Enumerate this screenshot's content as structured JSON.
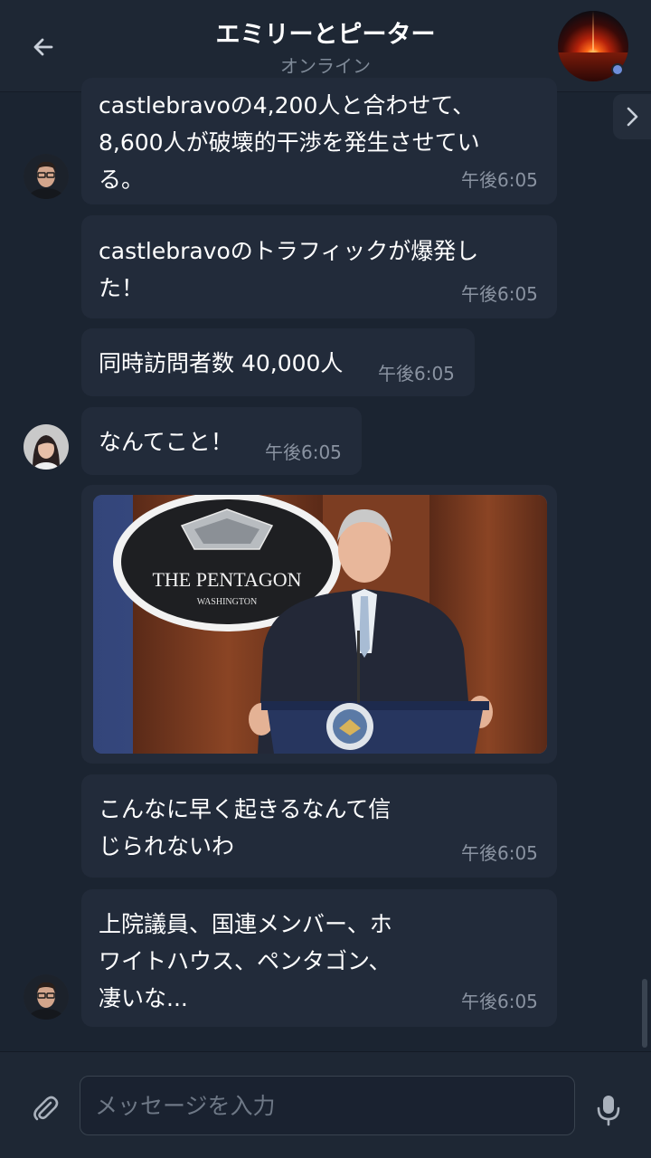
{
  "header": {
    "title": "エミリーとピーター",
    "status": "オンライン"
  },
  "messages": [
    {
      "text": "castlebravoの4,200人と合わせて、\n8,600人が破壊的干渉を発生させてい\nる。",
      "time": "午後6:05"
    },
    {
      "text": "castlebravoのトラフィックが爆発し\nた！",
      "time": "午後6:05"
    },
    {
      "text": "同時訪問者数 40,000人",
      "time": "午後6:05"
    },
    {
      "text": "なんてこと！",
      "time": "午後6:05"
    },
    {
      "image_caption_lines": [
        "THE PENTAGON",
        "WASHINGTON"
      ]
    },
    {
      "text": "こんなに早く起きるなんて信\nじられないわ",
      "time": "午後6:05"
    },
    {
      "text": "上院議員、国連メンバー、ホ\nワイトハウス、ペンタゴン、\n凄いな...",
      "time": "午後6:05"
    }
  ],
  "composer": {
    "placeholder": "メッセージを入力"
  },
  "colors": {
    "background": "#1b2431",
    "bubble": "#222b3a",
    "time_text": "#8a93a1",
    "online_dot": "#6f8fdc"
  },
  "icons": {
    "back": "arrow-left-icon",
    "expand": "chevron-right-icon",
    "attach": "paperclip-icon",
    "mic": "microphone-icon"
  }
}
